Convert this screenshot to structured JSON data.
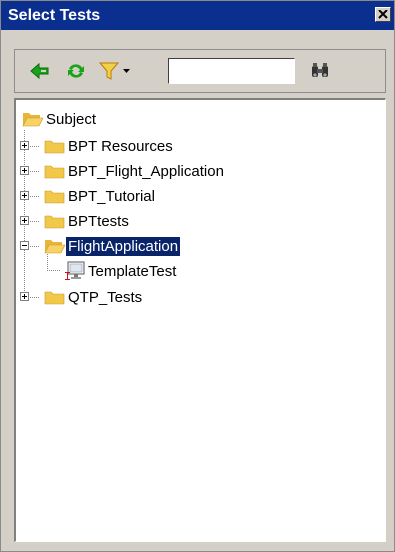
{
  "window": {
    "title": "Select Tests"
  },
  "toolbar": {
    "back_icon": "back-arrow-icon",
    "refresh_icon": "refresh-icon",
    "filter_icon": "filter-icon",
    "find_icon": "binoculars-icon",
    "search_value": ""
  },
  "tree": {
    "root": "Subject",
    "items": [
      {
        "label": "BPT Resources",
        "expanded": false
      },
      {
        "label": "BPT_Flight_Application",
        "expanded": false
      },
      {
        "label": "BPT_Tutorial",
        "expanded": false
      },
      {
        "label": "BPTtests",
        "expanded": false
      },
      {
        "label": "FlightApplication",
        "expanded": true,
        "selected": true,
        "children": [
          {
            "label": "TemplateTest"
          }
        ]
      },
      {
        "label": "QTP_Tests",
        "expanded": false
      }
    ]
  },
  "colors": {
    "title_bar": "#0b2f8f",
    "selection": "#0a246a",
    "folder": "#f2c84b",
    "arrow_green": "#1aa31a"
  }
}
